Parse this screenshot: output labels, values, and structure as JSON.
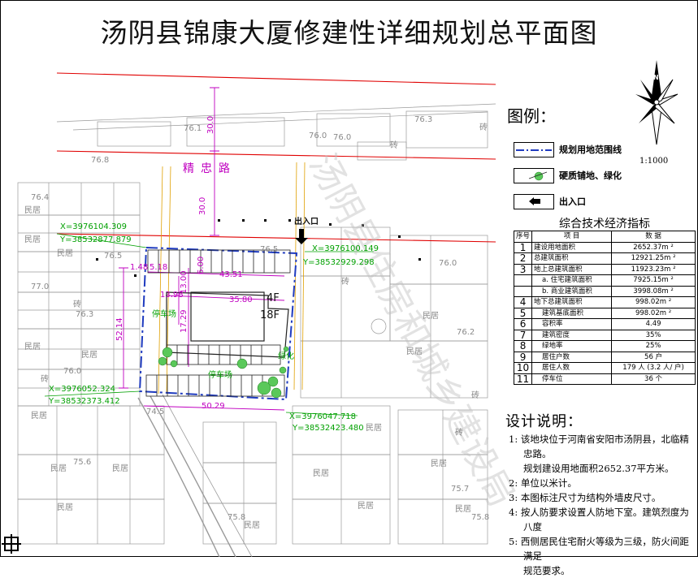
{
  "title": "汤阴县锦康大厦修建性详细规划总平面图",
  "map": {
    "road_name": "精忠路",
    "entrance_label": "出入口",
    "road_width_1": "30.0",
    "road_width_2": "30.0",
    "elevations": {
      "e1": "76.1",
      "e2": "76.0",
      "e3": "76.3",
      "e4": "76.8",
      "e5": "76.4",
      "e6": "76.5",
      "e7": "76.5",
      "e8": "77.0",
      "e9": "76.0",
      "e10": "76.3",
      "e11": "76.2",
      "e12": "76.0",
      "e13": "76.0",
      "e14": "74.5",
      "e15": "75.6",
      "e16": "75.8",
      "e17": "75.7",
      "e18": "75.8"
    },
    "coord_nw_x": "X=3976104.309",
    "coord_nw_y": "Y=38532877.879",
    "coord_ne_x": "X=3976100.149",
    "coord_ne_y": "Y=38532929.298",
    "coord_sw_x": "X=3976052.324",
    "coord_sw_y": "Y=38532373.412",
    "coord_se_x": "X=3976047.718",
    "coord_se_y": "Y=38532423.480",
    "dim_43_51": "43.51",
    "dim_35_80": "35.80",
    "dim_13_98": "13.98",
    "dim_13_00": "13.00",
    "dim_17_29": "17.29",
    "dim_52_14": "52.14",
    "dim_50_29": "50.29",
    "dim_1_48": "1.48",
    "dim_5_18": "5.18",
    "dim_6_00": "6.00",
    "floors_low": "4F",
    "floors_high": "18F",
    "parking_label": "停车场",
    "green_label": "绿化",
    "house_label": "民居",
    "brick_label": "砖",
    "watermark": "汤阴县住房和城乡建设局"
  },
  "legend": {
    "title": "图例：",
    "items": [
      {
        "label": "规划用地范围线"
      },
      {
        "label": "硬质铺地、绿化"
      },
      {
        "label": "出入口"
      }
    ]
  },
  "scale": "1:1000",
  "econ_table": {
    "title": "综合技术经济指标",
    "headers": [
      "序号",
      "项  目",
      "数  据"
    ],
    "rows": [
      {
        "no": "1",
        "item": "建设用地面积",
        "value": "2652.37m ²"
      },
      {
        "no": "2",
        "item": "总建筑面积",
        "value": "12921.25m ²"
      },
      {
        "no": "3",
        "item": "地上总建筑面积",
        "value": "11923.23m ²"
      },
      {
        "no": "",
        "item": "a. 住宅建筑面积",
        "value": "7925.15m ²"
      },
      {
        "no": "",
        "item": "b. 商业建筑面积",
        "value": "3998.08m ²"
      },
      {
        "no": "4",
        "item": "地下总建筑面积",
        "value": "998.02m ²"
      },
      {
        "no": "5",
        "item": "建筑基底面积",
        "value": "998.02m ²"
      },
      {
        "no": "6",
        "item": "容积率",
        "value": "4.49"
      },
      {
        "no": "7",
        "item": "建筑密度",
        "value": "35%"
      },
      {
        "no": "8",
        "item": "绿地率",
        "value": "25%"
      },
      {
        "no": "9",
        "item": "居住户数",
        "value": "56 户"
      },
      {
        "no": "10",
        "item": "居住人数",
        "value": "179 人 (3.2 人/ 户)"
      },
      {
        "no": "11",
        "item": "停车位",
        "value": "36 个"
      }
    ]
  },
  "design": {
    "title": "设计说明：",
    "notes": [
      {
        "line1": "1: 该地块位于河南省安阳市汤阴县，北临精忠路。",
        "line2": "规划建设用地面积2652.37平方米。"
      },
      {
        "line1": "2: 单位以米计。",
        "line2": ""
      },
      {
        "line1": "3: 本图标注尺寸为结构外墙皮尺寸。",
        "line2": ""
      },
      {
        "line1": "4: 按人防要求设置人防地下室。建筑烈度为八度",
        "line2": ""
      },
      {
        "line1": "5: 西侧居民住宅耐火等级为三级，防火间距满足",
        "line2": "规范要求。"
      }
    ]
  },
  "compass_letter": "N",
  "colors": {
    "red": "#e00000",
    "blue": "#1f3bbf",
    "magenta": "#c000c0",
    "green": "#00a000",
    "gray": "#9a9a9a"
  }
}
